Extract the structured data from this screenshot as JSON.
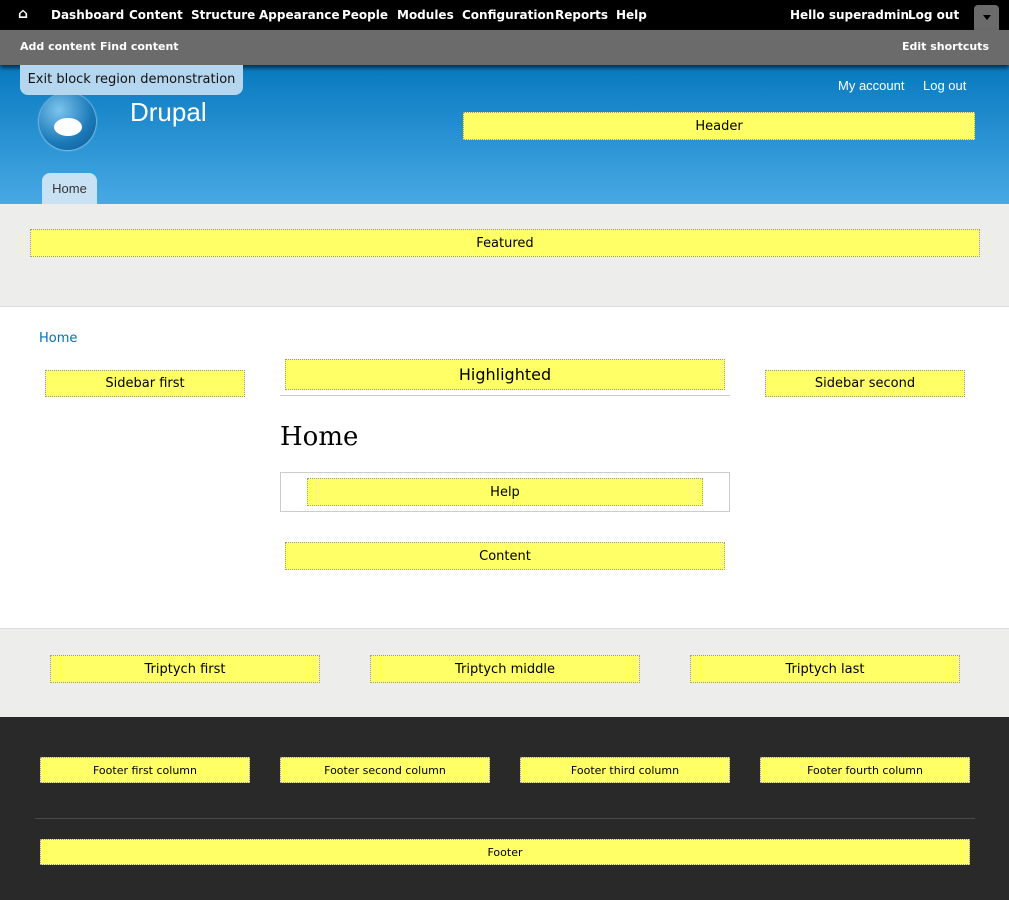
{
  "toolbar": {
    "items": [
      "Dashboard",
      "Content",
      "Structure",
      "Appearance",
      "People",
      "Modules",
      "Configuration",
      "Reports",
      "Help"
    ],
    "hello": "Hello ",
    "user": "superadmin",
    "logout": "Log out"
  },
  "shortcuts": {
    "add": "Add content",
    "find": "Find content",
    "edit": "Edit shortcuts"
  },
  "header": {
    "exit": "Exit block region demonstration",
    "site_name": "Drupal",
    "my_account": "My account",
    "logout": "Log out",
    "region": "Header",
    "tab_home": "Home"
  },
  "featured": "Featured",
  "main": {
    "breadcrumb": "Home",
    "sidebar_first": "Sidebar first",
    "highlighted": "Highlighted",
    "sidebar_second": "Sidebar second",
    "title": "Home",
    "help": "Help",
    "content": "Content"
  },
  "triptych": [
    "Triptych first",
    "Triptych middle",
    "Triptych last"
  ],
  "footer": {
    "columns": [
      "Footer first column",
      "Footer second column",
      "Footer third column",
      "Footer fourth column"
    ],
    "footer": "Footer"
  },
  "colors": {
    "accent": "#0071b3",
    "region": "#ffff66"
  }
}
